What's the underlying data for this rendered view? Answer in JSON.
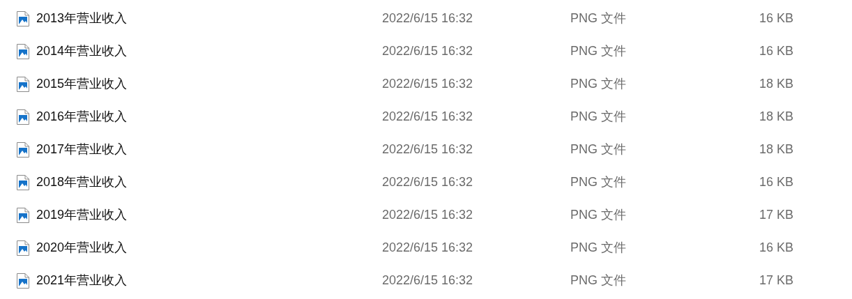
{
  "files": [
    {
      "name": "2013年营业收入",
      "modified": "2022/6/15 16:32",
      "type": "PNG 文件",
      "size": "16 KB"
    },
    {
      "name": "2014年营业收入",
      "modified": "2022/6/15 16:32",
      "type": "PNG 文件",
      "size": "16 KB"
    },
    {
      "name": "2015年营业收入",
      "modified": "2022/6/15 16:32",
      "type": "PNG 文件",
      "size": "18 KB"
    },
    {
      "name": "2016年营业收入",
      "modified": "2022/6/15 16:32",
      "type": "PNG 文件",
      "size": "18 KB"
    },
    {
      "name": "2017年营业收入",
      "modified": "2022/6/15 16:32",
      "type": "PNG 文件",
      "size": "18 KB"
    },
    {
      "name": "2018年营业收入",
      "modified": "2022/6/15 16:32",
      "type": "PNG 文件",
      "size": "16 KB"
    },
    {
      "name": "2019年营业收入",
      "modified": "2022/6/15 16:32",
      "type": "PNG 文件",
      "size": "17 KB"
    },
    {
      "name": "2020年营业收入",
      "modified": "2022/6/15 16:32",
      "type": "PNG 文件",
      "size": "16 KB"
    },
    {
      "name": "2021年营业收入",
      "modified": "2022/6/15 16:32",
      "type": "PNG 文件",
      "size": "17 KB"
    }
  ]
}
